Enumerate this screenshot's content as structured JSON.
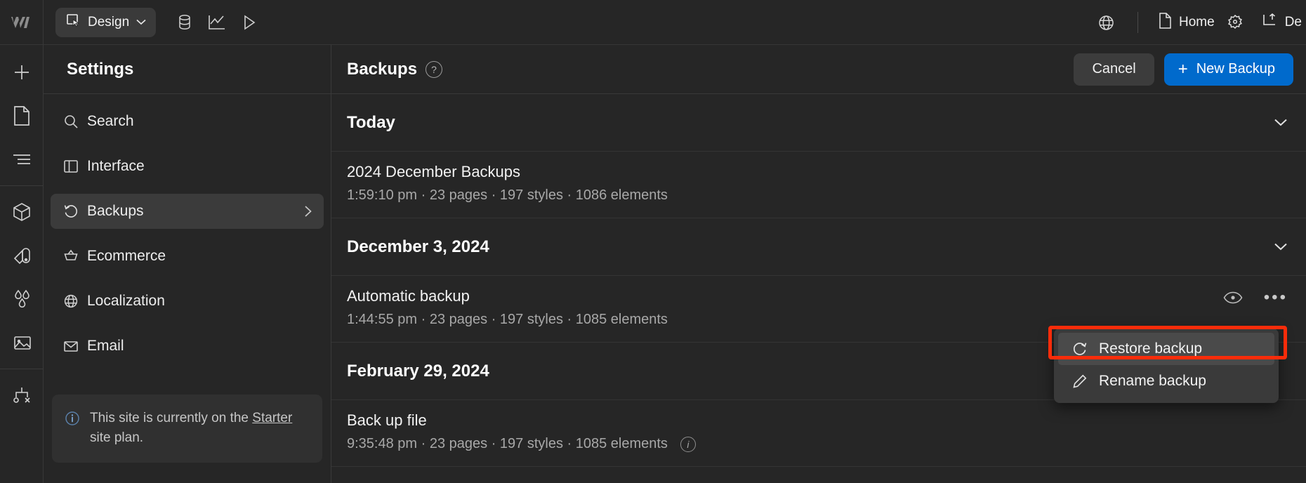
{
  "topbar": {
    "logo_icon": "webflow-logo-icon",
    "mode_button": {
      "label": "Design",
      "icon": "cursor-frame-icon",
      "chevron": "chevron-down-icon"
    },
    "tools": [
      {
        "name": "cms-database-icon"
      },
      {
        "name": "analytics-chart-icon"
      },
      {
        "name": "preview-play-icon"
      }
    ],
    "right": {
      "globe_icon": "globe-icon",
      "home_label": "Home",
      "home_icon": "page-icon",
      "settings_icon": "gear-asterisk-icon",
      "deploy_label": "De",
      "deploy_icon": "publish-frame-icon"
    }
  },
  "rail": {
    "items": [
      {
        "name": "add-panel-icon"
      },
      {
        "name": "pages-panel-icon"
      },
      {
        "name": "navigator-panel-icon"
      },
      {
        "name": "components-panel-icon"
      },
      {
        "name": "style-selector-panel-icon"
      },
      {
        "name": "variables-panel-icon"
      },
      {
        "name": "assets-panel-icon"
      },
      {
        "name": "audit-panel-icon"
      }
    ]
  },
  "settings": {
    "title": "Settings",
    "items": [
      {
        "label": "Search",
        "icon": "search-icon",
        "active": false,
        "chevron": false
      },
      {
        "label": "Interface",
        "icon": "interface-panel-icon",
        "active": false,
        "chevron": false
      },
      {
        "label": "Backups",
        "icon": "restore-clock-icon",
        "active": true,
        "chevron": true
      },
      {
        "label": "Ecommerce",
        "icon": "basket-icon",
        "active": false,
        "chevron": false
      },
      {
        "label": "Localization",
        "icon": "globe-icon",
        "active": false,
        "chevron": false
      },
      {
        "label": "Email",
        "icon": "envelope-icon",
        "active": false,
        "chevron": false
      }
    ],
    "plan_notice": {
      "icon": "info-icon",
      "text_before": "This site is currently on the ",
      "link": "Starter",
      "text_after": " site plan."
    }
  },
  "main": {
    "title": "Backups",
    "help_icon": "question-mark-icon",
    "cancel_label": "Cancel",
    "new_backup_label": "New Backup",
    "new_backup_plus": "+",
    "accent_color": "#006acc",
    "groups": [
      {
        "heading": "Today",
        "chevron": "chevron-down-icon",
        "rows": [
          {
            "title": "2024 December Backups",
            "meta": "1:59:10 pm · 23 pages · 197 styles · 1086 elements",
            "has_info": false,
            "has_actions": false
          }
        ]
      },
      {
        "heading": "December 3, 2024",
        "chevron": "chevron-down-icon",
        "rows": [
          {
            "title": "Automatic backup",
            "meta": "1:44:55 pm · 23 pages · 197 styles · 1085 elements",
            "has_info": false,
            "has_actions": true,
            "preview_icon": "eye-icon",
            "more_icon": "more-dots-icon"
          }
        ]
      },
      {
        "heading": "February 29, 2024",
        "chevron": "chevron-down-icon",
        "rows": [
          {
            "title": "Back up file",
            "meta": "9:35:48 pm · 23 pages · 197 styles · 1085 elements",
            "has_info": true,
            "info_icon": "info-icon",
            "has_actions": false
          }
        ]
      }
    ]
  },
  "context_menu": {
    "items": [
      {
        "label": "Restore backup",
        "icon": "restore-redo-icon",
        "highlighted": true
      },
      {
        "label": "Rename backup",
        "icon": "pencil-icon",
        "highlighted": false
      }
    ],
    "highlight_color": "#fa2c0a"
  }
}
